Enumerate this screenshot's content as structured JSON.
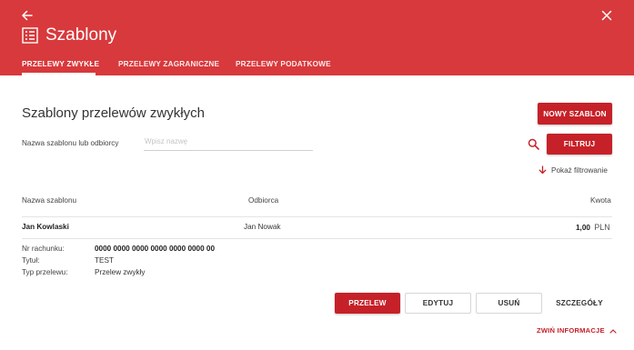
{
  "header": {
    "title": "Szablony",
    "tabs": [
      {
        "label": "PRZELEWY ZWYKŁE",
        "active": true
      },
      {
        "label": "PRZELEWY ZAGRANICZNE",
        "active": false
      },
      {
        "label": "PRZELEWY PODATKOWE",
        "active": false
      }
    ],
    "colors": {
      "background": "#d8393c",
      "primary_button": "#c62128"
    }
  },
  "main": {
    "section_title": "Szablony przelewów zwykłych",
    "new_template_label": "NOWY SZABLON",
    "filter": {
      "label": "Nazwa szablonu lub odbiorcy",
      "placeholder": "Wpisz nazwę",
      "value": "",
      "button_label": "FILTRUJ",
      "show_filter_label": "Pokaż filtrowanie"
    },
    "table": {
      "columns": [
        "Nazwa szablonu",
        "Odbiorca",
        "Kwota"
      ],
      "rows": [
        {
          "name": "Jan Kowlaski",
          "recipient": "Jan Nowak",
          "amount": "1,00",
          "currency": "PLN"
        }
      ]
    },
    "details": {
      "account_label": "Nr rachunku:",
      "account_value": "0000 0000 0000 0000 0000 0000 00",
      "title_label": "Tytuł:",
      "title_value": "TEST",
      "type_label": "Typ przelewu:",
      "type_value": "Przelew zwykły"
    },
    "actions": {
      "transfer": "PRZELEW",
      "edit": "EDYTUJ",
      "delete": "USUŃ",
      "details": "SZCZEGÓŁY"
    },
    "collapse_label": "ZWIŃ INFORMACJE"
  }
}
